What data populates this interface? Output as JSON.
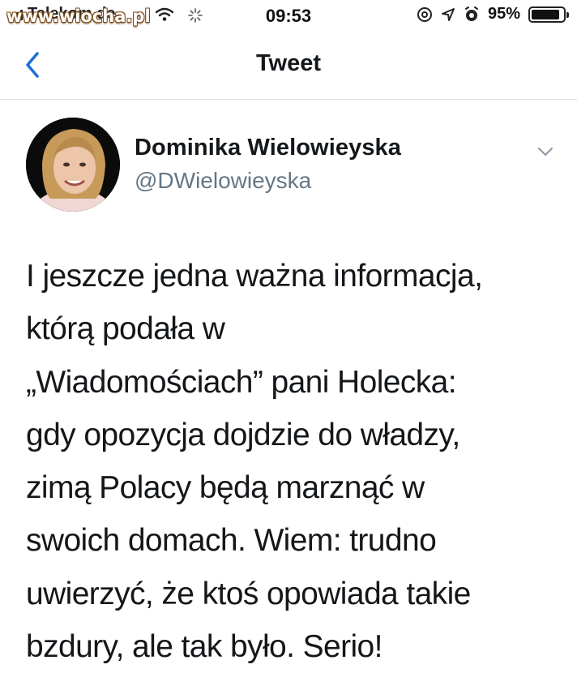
{
  "status_bar": {
    "carrier": "Telekom.de",
    "watermark": "www.wiocha.pl",
    "time": "09:53",
    "battery_percent": "95%",
    "battery_level": 0.95,
    "icons": [
      "signal-icon",
      "wifi-icon",
      "spinner-icon",
      "at-icon",
      "location-icon",
      "alarm-icon",
      "battery-icon"
    ]
  },
  "nav": {
    "title": "Tweet",
    "back_icon": "chevron-left-icon"
  },
  "author": {
    "name": "Dominika Wielowieyska",
    "handle": "@DWielowieyska",
    "menu_icon": "chevron-down-icon"
  },
  "tweet": {
    "lines": [
      "I jeszcze jedna ważna informacja,",
      "którą podała w",
      "„Wiadomościach” pani Holecka:",
      "gdy opozycja dojdzie do władzy,",
      "zimą Polacy będą marznąć w",
      "swoich domach. Wiem: trudno",
      "uwierzyć, że ktoś opowiada takie",
      "bzdury, ale tak było. Serio!"
    ]
  },
  "colors": {
    "accent": "#1da1f2",
    "back_arrow": "#1b6fd8",
    "text": "#14171a",
    "secondary_text": "#657786",
    "divider": "#dcdfe2"
  }
}
